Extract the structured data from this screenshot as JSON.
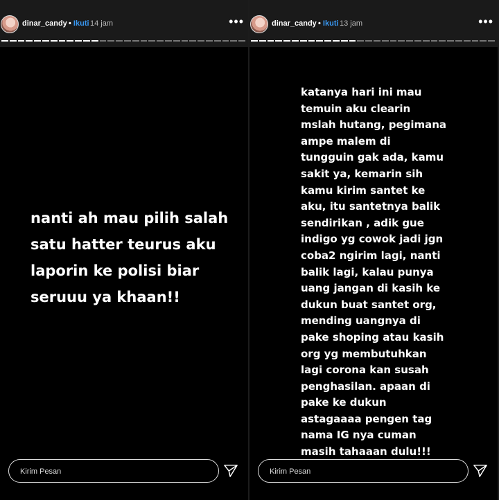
{
  "stories": [
    {
      "username": "dinar_candy",
      "follow_label": "Ikuti",
      "time": "14 jam",
      "segments_total": 30,
      "segments_done": 12,
      "text": "nanti ah mau pilih salah\nsatu hatter teurus aku\nlaporin ke polisi biar\nseruuu ya khaan!!",
      "reply_placeholder": "Kirim Pesan"
    },
    {
      "username": "dinar_candy",
      "follow_label": "Ikuti",
      "time": "13 jam",
      "segments_total": 30,
      "segments_done": 13,
      "text": "katanya hari ini mau\ntemuin aku clearin\nmslah hutang, pegimana\nampe malem di\ntungguin gak ada,  kamu\nsakit ya, kemarin sih\nkamu kirim santet ke\naku, itu santetnya balik\nsendirikan , adik gue\nindigo yg cowok jadi jgn\ncoba2 ngirim lagi, nanti\nbalik lagi, kalau punya\nuang jangan di kasih ke\ndukun buat santet org,\nmending uangnya di\npake shoping atau kasih\norg yg membutuhkan\nlagi corona kan susah\npenghasilan. apaan di\npake ke dukun\nastagaaaa pengen tag\nnama IG nya cuman\nmasih tahaaan dulu!!!",
      "reply_placeholder": "Kirim Pesan"
    }
  ],
  "icons": {
    "more": "more-options-icon",
    "send": "send-icon"
  },
  "colors": {
    "follow": "#3897f0",
    "story_bg": "#000000"
  }
}
